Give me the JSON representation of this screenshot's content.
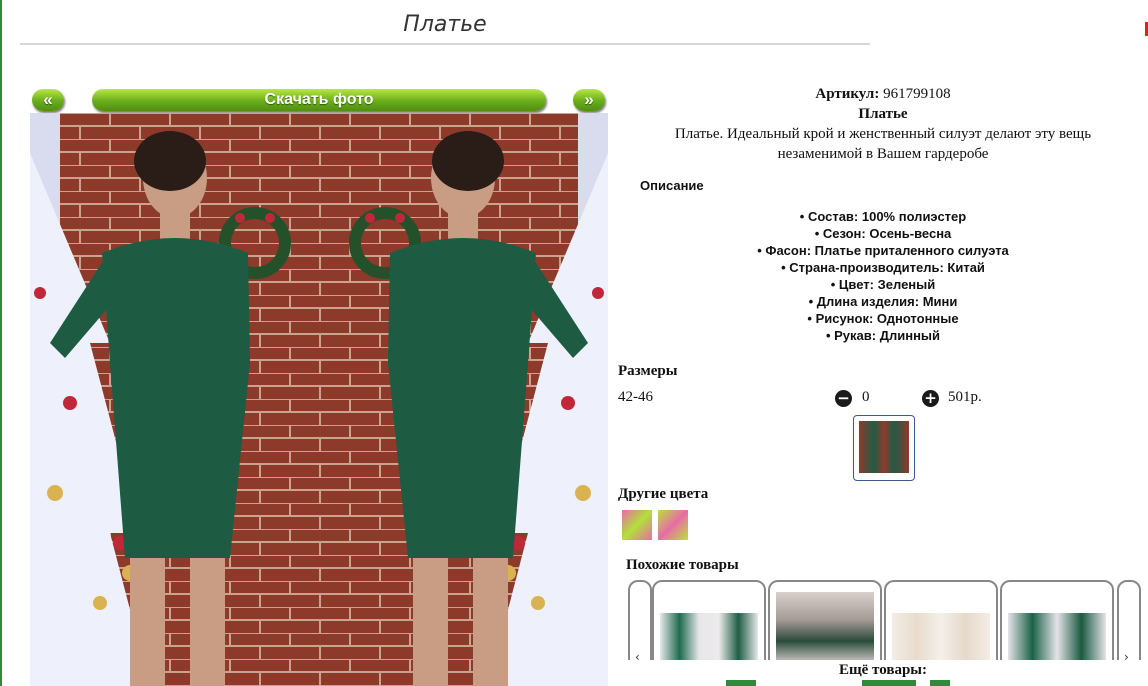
{
  "page": {
    "title": "Платье"
  },
  "toolbar": {
    "prev_label": "«",
    "download_label": "Скачать фото",
    "next_label": "»"
  },
  "product": {
    "sku_label": "Артикул:",
    "sku": "961799108",
    "name": "Платье",
    "description": "Платье. Идеальный крой и женственный силуэт делают эту вещь незаменимой в Вашем гардеробе"
  },
  "details": {
    "heading": "Описание",
    "specs": [
      "Состав: 100% полиэстер",
      "Сезон: Осень-весна",
      "Фасон: Платье приталенного силуэта",
      "Страна-производитель: Китай",
      "Цвет: Зеленый",
      "Длина изделия: Мини",
      "Рисунок: Однотонные",
      "Рукав: Длинный"
    ]
  },
  "sizes": {
    "heading": "Размеры",
    "rows": [
      {
        "size": "42-46",
        "quantity": "0",
        "price": "501р."
      }
    ],
    "minus_icon": "minus-circle-icon",
    "plus_icon": "plus-circle-icon"
  },
  "colors": {
    "heading": "Другие цвета",
    "swatches": [
      {
        "colors": [
          "#e96aa8",
          "#b2e03a"
        ]
      },
      {
        "colors": [
          "#b9e23b",
          "#e86ca6"
        ]
      }
    ]
  },
  "similar": {
    "heading": "Похожие товары",
    "prev_icon": "chevron-left-icon",
    "next_icon": "chevron-right-icon"
  },
  "more": {
    "label": "Ещё товары:"
  },
  "theme": {
    "accent": "#6aad1b",
    "border": "#2e8b3a"
  }
}
